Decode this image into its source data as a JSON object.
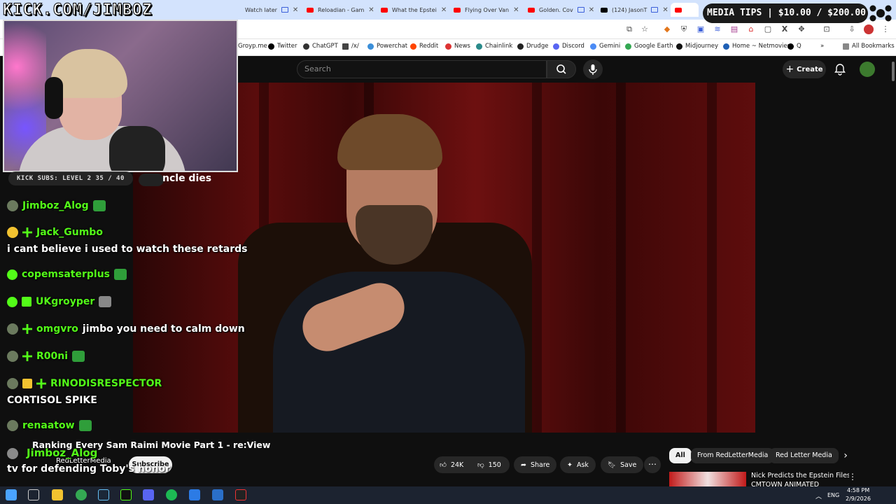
{
  "browser": {
    "tabs": [
      {
        "label": "Watch later",
        "kind": "yt"
      },
      {
        "label": "Reloadian - Gam",
        "kind": "yt"
      },
      {
        "label": "What the Epstei",
        "kind": "yt"
      },
      {
        "label": "Flying Over Van",
        "kind": "yt"
      },
      {
        "label": "Golden. Cov",
        "kind": "yt"
      },
      {
        "label": "(124) JasonT",
        "kind": "x"
      }
    ],
    "bookmarks": [
      {
        "label": "Groyp.me"
      },
      {
        "label": "Twitter"
      },
      {
        "label": "ChatGPT"
      },
      {
        "label": "/x/"
      },
      {
        "label": "Powerchat"
      },
      {
        "label": "Reddit"
      },
      {
        "label": "News"
      },
      {
        "label": "Chainlink"
      },
      {
        "label": "Drudge"
      },
      {
        "label": "Discord"
      },
      {
        "label": "Gemini"
      },
      {
        "label": "Google Earth"
      },
      {
        "label": "Midjourney"
      },
      {
        "label": "Home ~ Netmovies"
      },
      {
        "label": "Q"
      }
    ],
    "all_bookmarks": "All Bookmarks"
  },
  "stream_overlay": {
    "domain_text": "KICK.COM/JIMBOZ",
    "media_tips": "MEDIA TIPS | $10.00 / $200.00",
    "kick_subs": "KICK SUBS: LEVEL 2 35 / 40",
    "cut_text": "ncle dies"
  },
  "chat": [
    {
      "user": "Jimboz_Alog",
      "msg": "",
      "badges": [
        "avatar"
      ],
      "emote": "green"
    },
    {
      "user": "Jack_Gumbo",
      "msg": "",
      "badges": [
        "emoji",
        "plus"
      ],
      "emote": ""
    },
    {
      "user": "",
      "msg": "i cant believe i used to watch these retards",
      "badges": [],
      "emote": ""
    },
    {
      "user": "copemsaterplus",
      "msg": "",
      "badges": [
        "circ"
      ],
      "emote": "green"
    },
    {
      "user": "UKgroyper",
      "msg": "",
      "badges": [
        "circ",
        "sq"
      ],
      "emote": "grey"
    },
    {
      "user": "omgvro",
      "msg": "jimbo you need to calm down",
      "badges": [
        "avatar",
        "plus"
      ],
      "emote": ""
    },
    {
      "user": "R00ni",
      "msg": "",
      "badges": [
        "avatar",
        "plus"
      ],
      "emote": "green"
    },
    {
      "user": "RINODISRESPECTOR",
      "msg": "",
      "badges": [
        "avatar",
        "sq",
        "plus"
      ],
      "emote": ""
    },
    {
      "user": "",
      "msg": "CORTISOL SPIKE",
      "badges": [],
      "emote": ""
    },
    {
      "user": "renaatow",
      "msg": "",
      "badges": [
        "avatar"
      ],
      "emote": "green"
    }
  ],
  "overlay_bottom": {
    "user": "Jimboz_Alog",
    "msg": "tv for defending Toby's honor"
  },
  "youtube": {
    "search_placeholder": "Search",
    "create_label": "Create",
    "video_title": "Ranking Every Sam Raimi Movie Part 1 - re:View",
    "channel": "RedLetterMedia",
    "subscribe": "Subscribe",
    "likes": "24K",
    "dislikes": "150",
    "share": "Share",
    "ask": "Ask",
    "save": "Save",
    "chips": [
      "All",
      "From RedLetterMedia",
      "Red Letter Media"
    ],
    "rec_title": "Nick Predicts the Epstein Files |",
    "rec_sub": "CMTOWN ANIMATED"
  },
  "taskbar": {
    "lang": "ENG",
    "time": "4:58 PM",
    "date": "2/9/2026"
  },
  "colors": {
    "kick_green": "#53fc18",
    "yt_bg": "#0f0f0f",
    "tab_bg": "#d3e3fd"
  }
}
